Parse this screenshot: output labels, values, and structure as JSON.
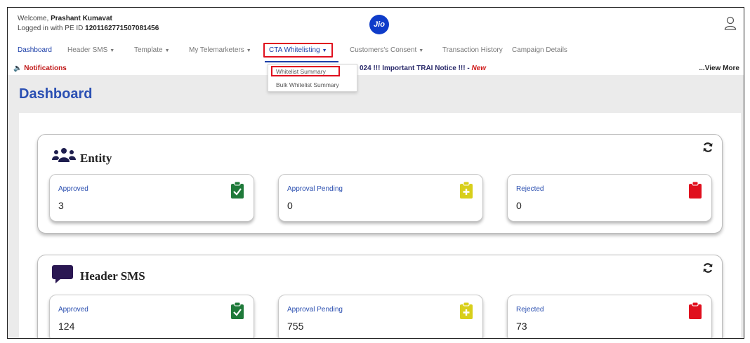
{
  "header": {
    "welcome_prefix": "Welcome, ",
    "user_name": "Prashant Kumavat",
    "login_prefix": "Logged in with PE ID ",
    "pe_id": "1201162771507081456",
    "logo_text": "Jio"
  },
  "nav": {
    "items": [
      {
        "label": "Dashboard",
        "caret": ""
      },
      {
        "label": "Header SMS",
        "caret": "▼"
      },
      {
        "label": "Template",
        "caret": "▼"
      },
      {
        "label": "My Telemarketers",
        "caret": "▼"
      },
      {
        "label": "CTA Whitelisting",
        "caret": "▼"
      },
      {
        "label": "Customers's Consent",
        "caret": "▼"
      },
      {
        "label": "Transaction History",
        "caret": ""
      },
      {
        "label": "Campaign Details",
        "caret": ""
      }
    ]
  },
  "dropdown": {
    "items": [
      "Whitelist Summary",
      "Bulk Whitelist Summary"
    ]
  },
  "notifications": {
    "label": "🔈 Notifications",
    "text": "024 !!! Important TRAI Notice !!! - ",
    "new_tag": "New",
    "view_more": "...View More"
  },
  "page_title": "Dashboard",
  "sections": [
    {
      "title": "Entity",
      "icon": "users-icon",
      "stats": [
        {
          "label": "Approved",
          "value": "3",
          "color": "#1f7a3a"
        },
        {
          "label": "Approval Pending",
          "value": "0",
          "color": "#d8cf1b"
        },
        {
          "label": "Rejected",
          "value": "0",
          "color": "#e0101e"
        }
      ]
    },
    {
      "title": "Header SMS",
      "icon": "comment-icon",
      "stats": [
        {
          "label": "Approved",
          "value": "124",
          "color": "#1f7a3a"
        },
        {
          "label": "Approval Pending",
          "value": "755",
          "color": "#d8cf1b"
        },
        {
          "label": "Rejected",
          "value": "73",
          "color": "#e0101e"
        }
      ]
    }
  ]
}
